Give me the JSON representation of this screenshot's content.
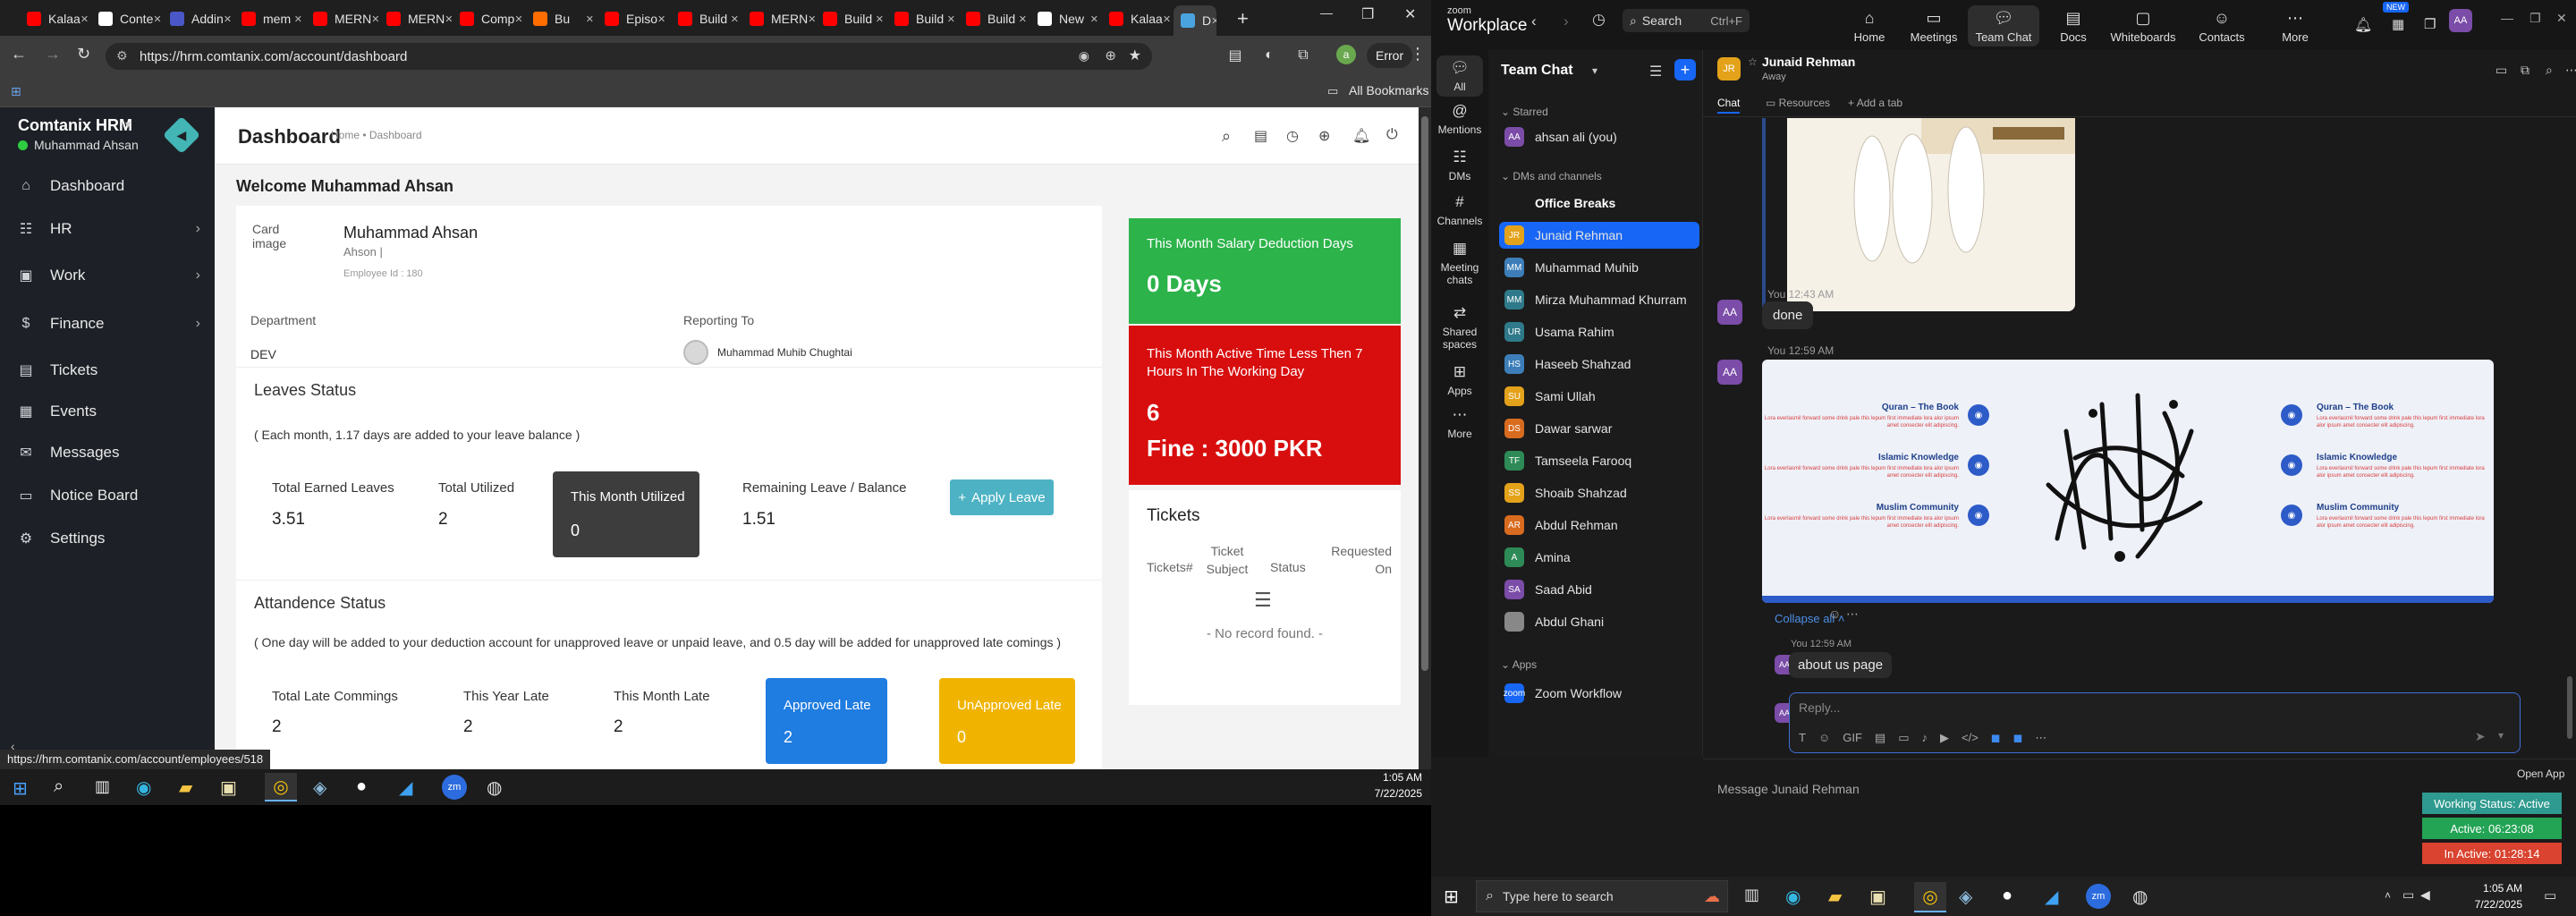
{
  "left_browser": {
    "tabs": [
      {
        "label": "Kalaa",
        "color": "#ff0000"
      },
      {
        "label": "Conte",
        "color": "#ffffff"
      },
      {
        "label": "Addin",
        "color": "#4a57c8"
      },
      {
        "label": "mem",
        "color": "#ff0000"
      },
      {
        "label": "MERN",
        "color": "#ff0000"
      },
      {
        "label": "MERN",
        "color": "#ff0000"
      },
      {
        "label": "Comp",
        "color": "#ff0000"
      },
      {
        "label": "Bu",
        "color": "#ff6d00"
      },
      {
        "label": "Episo",
        "color": "#ff0000"
      },
      {
        "label": "Build",
        "color": "#ff0000"
      },
      {
        "label": "MERN",
        "color": "#ff0000"
      },
      {
        "label": "Build",
        "color": "#ff0000"
      },
      {
        "label": "Build",
        "color": "#ff0000"
      },
      {
        "label": "Build",
        "color": "#ff0000"
      },
      {
        "label": "New",
        "color": "#ffffff"
      },
      {
        "label": "Kalaa",
        "color": "#ff0000"
      },
      {
        "label": "D",
        "color": "#4aa3df"
      }
    ],
    "url": "https://hrm.comtanix.com/account/dashboard",
    "error_label": "Error",
    "bookmarks_label": "All Bookmarks",
    "status_url": "https://hrm.comtanix.com/account/employees/518"
  },
  "hrm": {
    "brand": "Comtanix HRM",
    "user": "Muhammad Ahsan",
    "sidebar": [
      {
        "label": "Dashboard",
        "icon": "home-icon",
        "glyph": "⌂",
        "chevron": false
      },
      {
        "label": "HR",
        "icon": "people-icon",
        "glyph": "☷",
        "chevron": true
      },
      {
        "label": "Work",
        "icon": "briefcase-icon",
        "glyph": "▣",
        "chevron": true
      },
      {
        "label": "Finance",
        "icon": "dollar-icon",
        "glyph": "$",
        "chevron": true
      },
      {
        "label": "Tickets",
        "icon": "ticket-icon",
        "glyph": "▤",
        "chevron": false
      },
      {
        "label": "Events",
        "icon": "calendar-icon",
        "glyph": "▦",
        "chevron": false
      },
      {
        "label": "Messages",
        "icon": "message-icon",
        "glyph": "✉",
        "chevron": false
      },
      {
        "label": "Notice Board",
        "icon": "board-icon",
        "glyph": "▭",
        "chevron": false
      },
      {
        "label": "Settings",
        "icon": "gear-icon",
        "glyph": "⚙",
        "chevron": false
      }
    ],
    "page_title": "Dashboard",
    "breadcrumb": "Home • Dashboard",
    "welcome": "Welcome Muhammad Ahsan",
    "profile": {
      "img_alt": "Card image",
      "name": "Muhammad Ahsan",
      "nick": "Ahson |",
      "emp_id": "Employee Id : 180",
      "department_label": "Department",
      "department": "DEV",
      "reporting_label": "Reporting To",
      "reporting_to": "Muhammad Muhib Chughtai"
    },
    "leaves": {
      "title": "Leaves Status",
      "note": "( Each month, 1.17 days are added to your leave balance )",
      "earned_label": "Total Earned Leaves",
      "earned": "3.51",
      "utilized_label": "Total Utilized",
      "utilized": "2",
      "month_label": "This Month Utilized",
      "month": "0",
      "remaining_label": "Remaining Leave / Balance",
      "remaining": "1.51",
      "apply": "Apply Leave"
    },
    "attendance": {
      "title": "Attandence Status",
      "note": "( One day will be added to your deduction account for unapproved leave or unpaid leave, and 0.5 day will be added for unapproved late comings )",
      "late_label": "Total Late Commings",
      "late": "2",
      "year_label": "This Year Late",
      "year": "2",
      "month_label": "This Month Late",
      "month": "2",
      "approved_label": "Approved Late",
      "approved": "2",
      "unapproved_label": "UnApproved Late",
      "unapproved": "0"
    },
    "salary": {
      "title": "This Month Salary Deduction Days",
      "value": "0 Days"
    },
    "active_time": {
      "title": "This Month Active Time Less Then 7 Hours In The Working Day",
      "value": "6",
      "fine": "Fine : 3000 PKR"
    },
    "tickets": {
      "title": "Tickets",
      "cols": [
        "Tickets#",
        "Ticket Subject",
        "Status",
        "Requested On"
      ],
      "empty": "- No record found. -"
    }
  },
  "left_taskbar": {
    "time": "1:05 AM",
    "date": "7/22/2025"
  },
  "zoom": {
    "logo_top": "zoom",
    "logo": "Workplace",
    "search": "Search",
    "search_shortcut": "Ctrl+F",
    "nav": [
      "Home",
      "Meetings",
      "Team Chat",
      "Docs",
      "Whiteboards",
      "Contacts",
      "More"
    ],
    "new_badge": "NEW",
    "rail": [
      "All",
      "Mentions",
      "DMs",
      "Channels",
      "Meeting chats",
      "Shared spaces",
      "Apps",
      "More"
    ],
    "panel_title": "Team Chat",
    "starred_header": "Starred",
    "starred": [
      {
        "name": "ahsan ali (you)",
        "initials": "AA",
        "color": "#7b4ca8"
      }
    ],
    "dms_header": "DMs and channels",
    "channels": [
      {
        "name": "Office Breaks",
        "initials": "",
        "color": "#1b1b1b",
        "bold": true
      },
      {
        "name": "Junaid Rehman",
        "initials": "JR",
        "color": "#e3a21a"
      },
      {
        "name": "Muhammad Muhib",
        "initials": "MM",
        "color": "#3d7eb9"
      },
      {
        "name": "Mirza Muhammad Khurram",
        "initials": "MM",
        "color": "#2f7a8a"
      },
      {
        "name": "Usama Rahim",
        "initials": "UR",
        "color": "#2f7a8a"
      },
      {
        "name": "Haseeb Shahzad",
        "initials": "HS",
        "color": "#3d7eb9"
      },
      {
        "name": "Sami Ullah",
        "initials": "SU",
        "color": "#e3a21a"
      },
      {
        "name": "Dawar sarwar",
        "initials": "DS",
        "color": "#d96b1f"
      },
      {
        "name": "Tamseela Farooq",
        "initials": "TF",
        "color": "#2e8b57"
      },
      {
        "name": "Shoaib Shahzad",
        "initials": "SS",
        "color": "#e3a21a"
      },
      {
        "name": "Abdul Rehman",
        "initials": "AR",
        "color": "#d96b1f"
      },
      {
        "name": "Amina",
        "initials": "A",
        "color": "#2e8b57"
      },
      {
        "name": "Saad Abid",
        "initials": "SA",
        "color": "#7b4ca8"
      },
      {
        "name": "Abdul Ghani",
        "initials": "",
        "color": "#888888"
      }
    ],
    "apps_header": "Apps",
    "apps": [
      {
        "name": "Zoom Workflow",
        "initials": "zoom",
        "color": "#1766f5"
      }
    ],
    "chat_name": "Junaid Rehman",
    "chat_status": "Away",
    "chat_tabs": [
      "Chat",
      "Resources",
      "Add a tab"
    ],
    "messages": [
      {
        "time": "You 12:43 AM",
        "text": "done"
      },
      {
        "time": "You 12:59 AM",
        "text": ""
      }
    ],
    "image_labels": {
      "left": [
        {
          "title": "Quran – The Book",
          "body": "Lora everlasmil forward some drink pale this lepum first immediate lora alor ipsum amet consecter elit adipiscing."
        },
        {
          "title": "Islamic Knowledge",
          "body": "Lora everlasmil forward some drink pale this lepum first immediate lora alor ipsum amet consecter elit adipiscing."
        },
        {
          "title": "Muslim Community",
          "body": "Lora everlasmil forward some drink pale this lepum first immediate lora alor ipsum amet consecter elit adipiscing."
        }
      ],
      "right": [
        {
          "title": "Quran – The Book",
          "body": "Lora everlasmil forward some drink pale this lepum first immediate lora alor ipsum amet consecter elit adipiscing."
        },
        {
          "title": "Islamic Knowledge",
          "body": "Lora everlasmil forward some drink pale this lepum first immediate lora alor ipsum amet consecter elit adipiscing."
        },
        {
          "title": "Muslim Community",
          "body": "Lora everlasmil forward some drink pale this lepum first immediate lora alor ipsum amet consecter elit adipiscing."
        }
      ]
    },
    "collapse": "Collapse all",
    "last_time": "You 12:59 AM",
    "last_text": "about us page",
    "reply_placeholder": "Reply...",
    "message_placeholder": "Message Junaid Rehman",
    "open_app": "Open App",
    "working_status": "Working Status: Active",
    "active_time": "Active: 06:23:08",
    "inactive_time": "In Active: 01:28:14",
    "search_taskbar": "Type here to search",
    "time": "1:05 AM",
    "date": "7/22/2025"
  }
}
